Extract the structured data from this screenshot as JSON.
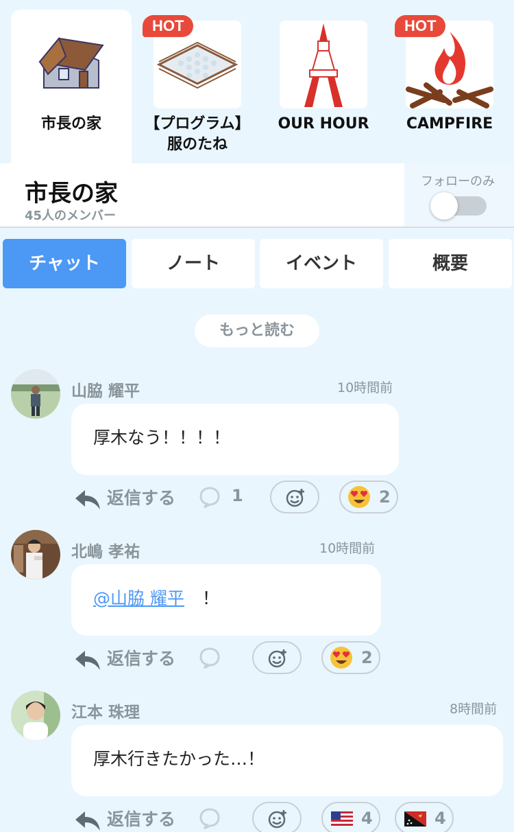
{
  "communities": [
    {
      "title": "市長の家",
      "hot": false,
      "icon": "house-icon"
    },
    {
      "title": "【プログラム】\n服のたね",
      "hot": true,
      "icon": "fenced-field-icon"
    },
    {
      "title": "OUR HOUR",
      "hot": false,
      "icon": "tower-icon"
    },
    {
      "title": "CAMPFIRE",
      "hot": true,
      "icon": "campfire-icon"
    }
  ],
  "hot_label": "HOT",
  "group": {
    "name": "市長の家",
    "members": "45人のメンバー",
    "follow_label": "フォローのみ",
    "follow_only": false
  },
  "tabs": [
    "チャット",
    "ノート",
    "イベント",
    "概要"
  ],
  "more_label": "もっと読む",
  "reply_label": "返信する",
  "messages": [
    {
      "author": "山脇 耀平",
      "time": "10時間前",
      "text": "厚木なう！！！！",
      "comments": "1",
      "reactions": [
        {
          "emoji": "heart-eyes-emoji",
          "count": "2"
        }
      ]
    },
    {
      "author": "北嶋 孝祐",
      "time": "10時間前",
      "mention": "@山脇 耀平",
      "text": "！",
      "reactions": [
        {
          "emoji": "heart-eyes-emoji",
          "count": "2"
        }
      ]
    },
    {
      "author": "江本 珠理",
      "time": "8時間前",
      "text": "厚木行きたかった…！",
      "reactions": [
        {
          "emoji": "us-flag-emoji",
          "count": "4"
        },
        {
          "emoji": "papua-new-guinea-flag-emoji",
          "count": "4"
        }
      ]
    }
  ],
  "colors": {
    "background": "#e9f6fd",
    "accent": "#4c98f5",
    "hot": "#e8493a",
    "muted": "#8a949b"
  }
}
